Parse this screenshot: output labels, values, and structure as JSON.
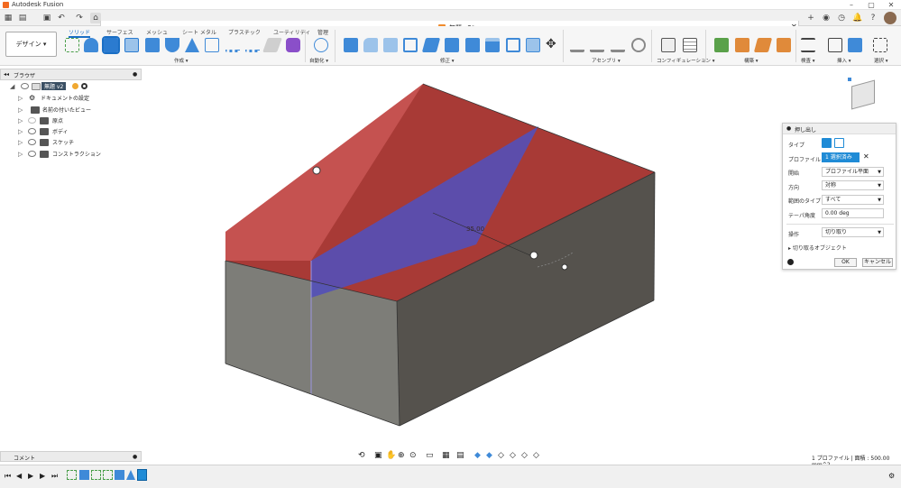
{
  "app": {
    "title": "Autodesk Fusion"
  },
  "document": {
    "tab_title": "無題 v2*"
  },
  "ribbon": {
    "workspace_label": "デザイン ▾",
    "tabs": [
      "ソリッド",
      "サーフェス",
      "メッシュ",
      "シート メタル",
      "プラスチック",
      "ユーティリティ",
      "管理"
    ],
    "groups": [
      "作成 ▾",
      "自動化 ▾",
      "修正 ▾",
      "アセンブリ ▾",
      "コンフィギュレーション ▾",
      "構築 ▾",
      "検査 ▾",
      "挿入 ▾",
      "選択 ▾"
    ]
  },
  "browser": {
    "title": "ブラウザ",
    "root": "無題 v2",
    "items": [
      "ドキュメントの設定",
      "名前の付いたビュー",
      "原点",
      "ボディ",
      "スケッチ",
      "コンストラクション"
    ]
  },
  "viewport": {
    "dimension_label": "35.00"
  },
  "extrude_panel": {
    "title": "押し出し",
    "type_label": "タイプ",
    "profile_label": "プロファイル",
    "profile_value": "1 選択済み",
    "start_label": "開始",
    "start_value": "プロファイル平面",
    "direction_label": "方向",
    "direction_value": "対称",
    "extent_label": "範囲のタイプ",
    "extent_value": "すべて",
    "taper_label": "テーパ角度",
    "taper_value": "0.00 deg",
    "operation_label": "操作",
    "operation_value": "切り取り",
    "objects_label": "切り取るオブジェクト",
    "ok_label": "OK",
    "cancel_label": "キャンセル"
  },
  "comments": {
    "label": "コメント"
  },
  "status": {
    "text": "1 プロファイル | 面積 : 500.00 mm^2"
  },
  "colors": {
    "accent": "#1b6fc5",
    "body_top": "#a83a36",
    "body_side": "#55524d",
    "profile_fill": "#5350b8"
  }
}
